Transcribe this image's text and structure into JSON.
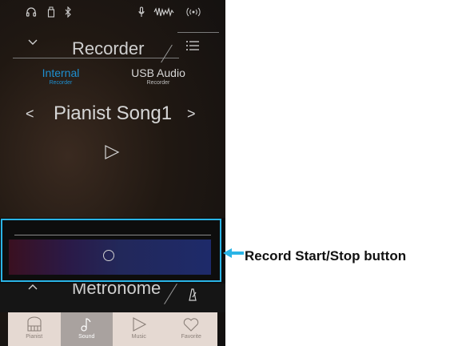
{
  "status_icons": [
    "headphones-icon",
    "usb-memory-icon",
    "bluetooth-icon",
    "microphone-icon",
    "audio-level-icon",
    "wireless-icon"
  ],
  "header": {
    "title": "Recorder",
    "chevron_icon": "chevron-down-icon",
    "menu_icon": "list-menu-icon"
  },
  "tabs": [
    {
      "label": "Internal",
      "sublabel": "Recorder",
      "active": true
    },
    {
      "label": "USB Audio",
      "sublabel": "Recorder",
      "active": false
    }
  ],
  "song": {
    "name": "Pianist Song1",
    "prev": "<",
    "next": ">"
  },
  "record_button": {
    "icon": "record-circle-icon"
  },
  "callout": {
    "text": "Record Start/Stop button"
  },
  "metronome": {
    "label": "Metronome",
    "icon": "metronome-icon"
  },
  "bottom_nav": [
    {
      "label": "Pianist",
      "icon": "piano-icon",
      "active": false
    },
    {
      "label": "Sound",
      "icon": "music-note-icon",
      "active": true
    },
    {
      "label": "Music",
      "icon": "play-icon",
      "active": false
    },
    {
      "label": "Favorite",
      "icon": "heart-icon",
      "active": false
    }
  ],
  "colors": {
    "accent": "#1e8fd0",
    "highlight_box": "#2ab4e6",
    "nav_bg": "#e5d9d2",
    "nav_active": "#a9a29f"
  }
}
